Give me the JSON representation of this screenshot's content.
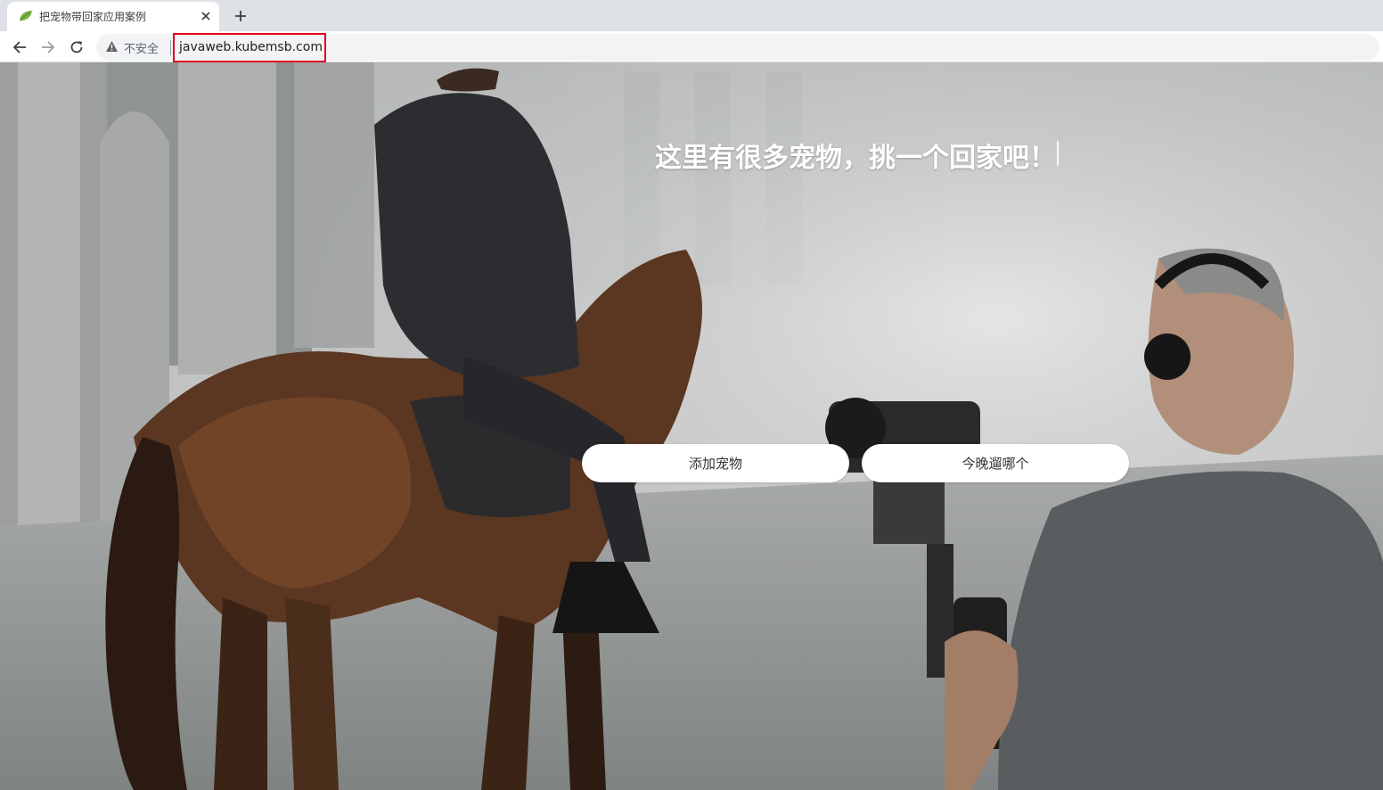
{
  "browser": {
    "tab": {
      "title": "把宠物带回家应用案例",
      "favicon": "leaf-icon"
    },
    "new_tab_icon": "plus-icon",
    "toolbar": {
      "back_icon": "arrow-left-icon",
      "forward_icon": "arrow-right-icon",
      "reload_icon": "reload-icon",
      "security_icon": "warning-triangle-icon",
      "security_label": "不安全",
      "url": "javaweb.kubemsb.com"
    },
    "highlight_color": "#e0001b"
  },
  "hero": {
    "headline": "这里有很多宠物，挑一个回家吧！",
    "buttons": [
      {
        "label": "添加宠物"
      },
      {
        "label": "今晚遛哪个"
      }
    ]
  }
}
